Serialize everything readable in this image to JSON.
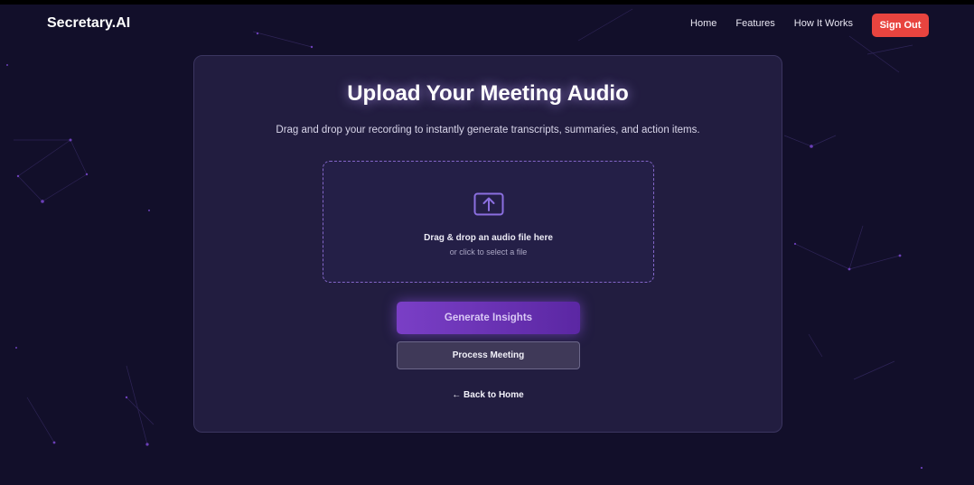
{
  "app": {
    "brand": "Secretary.AI"
  },
  "nav": {
    "links": [
      "Home",
      "Features",
      "How It Works"
    ],
    "sign_out": "Sign Out"
  },
  "upload": {
    "title": "Upload Your Meeting Audio",
    "subtitle": "Drag and drop your recording to instantly generate transcripts, summaries, and action items.",
    "dropzone_title": "Drag & drop an audio file here",
    "dropzone_sub": "or click to select a file",
    "icon": "upload-icon"
  },
  "actions": {
    "generate": "Generate Insights",
    "process": "Process Meeting",
    "back": "← Back to Home"
  },
  "colors": {
    "background": "#120f2a",
    "card": "#221d40",
    "accent": "#7a3fc6",
    "sign_out": "#e8443f"
  }
}
